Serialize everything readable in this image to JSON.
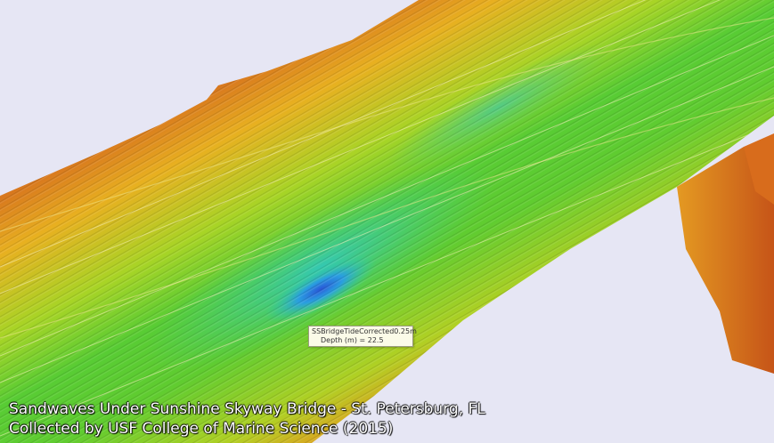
{
  "tooltip": {
    "layer": "SSBridgeTideCorrected0.25m",
    "depth_label": "Depth (m) = 22.5"
  },
  "caption": {
    "line1": "Sandwaves Under Sunshine Skyway Bridge - St. Petersburg, FL",
    "line2": "Collected by USF College of Marine Science (2015)"
  },
  "colors": {
    "background": "#e6e6f4",
    "shallow": "#c85a1c",
    "mid_shallow": "#e8a020",
    "mid": "#7ad02a",
    "deep": "#20c8a0",
    "deepest": "#2060d8"
  }
}
